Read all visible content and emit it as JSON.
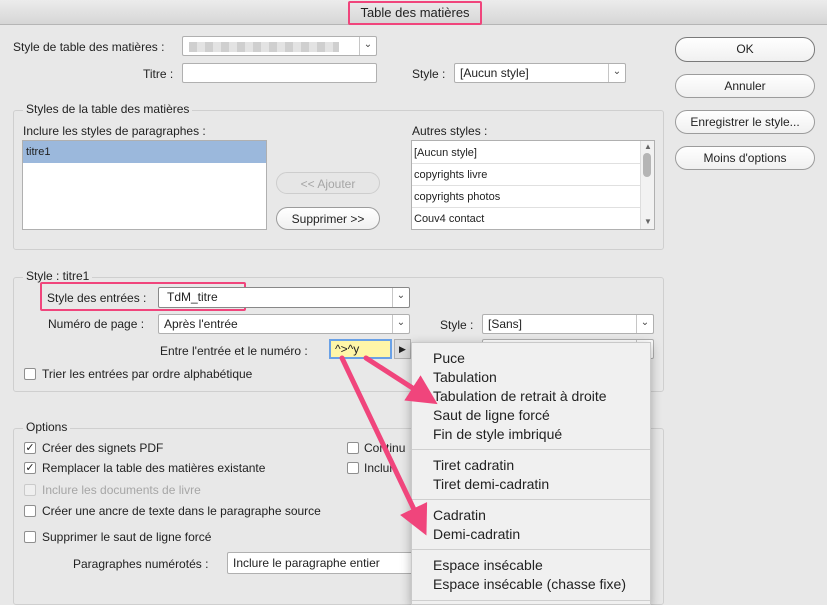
{
  "window": {
    "title": "Table des matières"
  },
  "top": {
    "toc_style_label": "Style de table des matières :",
    "titre_label": "Titre :",
    "title_style_label": "Style :",
    "title_style_value": "[Aucun style]"
  },
  "buttons": {
    "ok": "OK",
    "cancel": "Annuler",
    "save_style": "Enregistrer le style...",
    "fewer_options": "Moins d'options"
  },
  "styles_group": {
    "title": "Styles de la table des matières",
    "include_label": "Inclure les styles de paragraphes :",
    "included": [
      "titre1"
    ],
    "add_button": "<< Ajouter",
    "remove_button": "Supprimer >>",
    "other_label": "Autres styles :",
    "other": [
      "[Aucun style]",
      "copyrights livre",
      "copyrights photos",
      "Couv4 contact"
    ]
  },
  "style_group": {
    "title": "Style : titre1",
    "entry_style_label": "Style des entrées :",
    "entry_style_value": "TdM_titre",
    "page_number_label": "Numéro de page :",
    "page_number_value": "Après l'entrée",
    "page_style_label": "Style :",
    "page_style_value": "[Sans]",
    "between_label": "Entre l'entrée et le numéro :",
    "between_value": "^>^y",
    "sort_label": "Trier les entrées par ordre alphabétique"
  },
  "options_group": {
    "title": "Options",
    "create_pdf_bookmarks": "Créer des signets PDF",
    "replace_existing": "Remplacer la table des matières existante",
    "include_book_docs": "Inclure les documents de livre",
    "create_anchor": "Créer une ancre de texte dans le paragraphe source",
    "remove_line_break": "Supprimer le saut de ligne forcé",
    "numbered_label": "Paragraphes numérotés :",
    "numbered_value": "Inclure le paragraphe entier",
    "right_cb1_label": "Continu",
    "right_cb2_label": "Inclur"
  },
  "menu": {
    "items": [
      [
        "Puce",
        "Tabulation",
        "Tabulation de retrait à droite",
        "Saut de ligne forcé",
        "Fin de style imbriqué"
      ],
      [
        "Tiret cadratin",
        "Tiret demi-cadratin"
      ],
      [
        "Cadratin",
        "Demi-cadratin"
      ],
      [
        "Espace insécable",
        "Espace insécable (chasse fixe)"
      ]
    ]
  },
  "colors": {
    "annotation_pink": "#f0457c",
    "selection_blue": "#9bb8dc",
    "field_highlight": "#fff6a8"
  }
}
